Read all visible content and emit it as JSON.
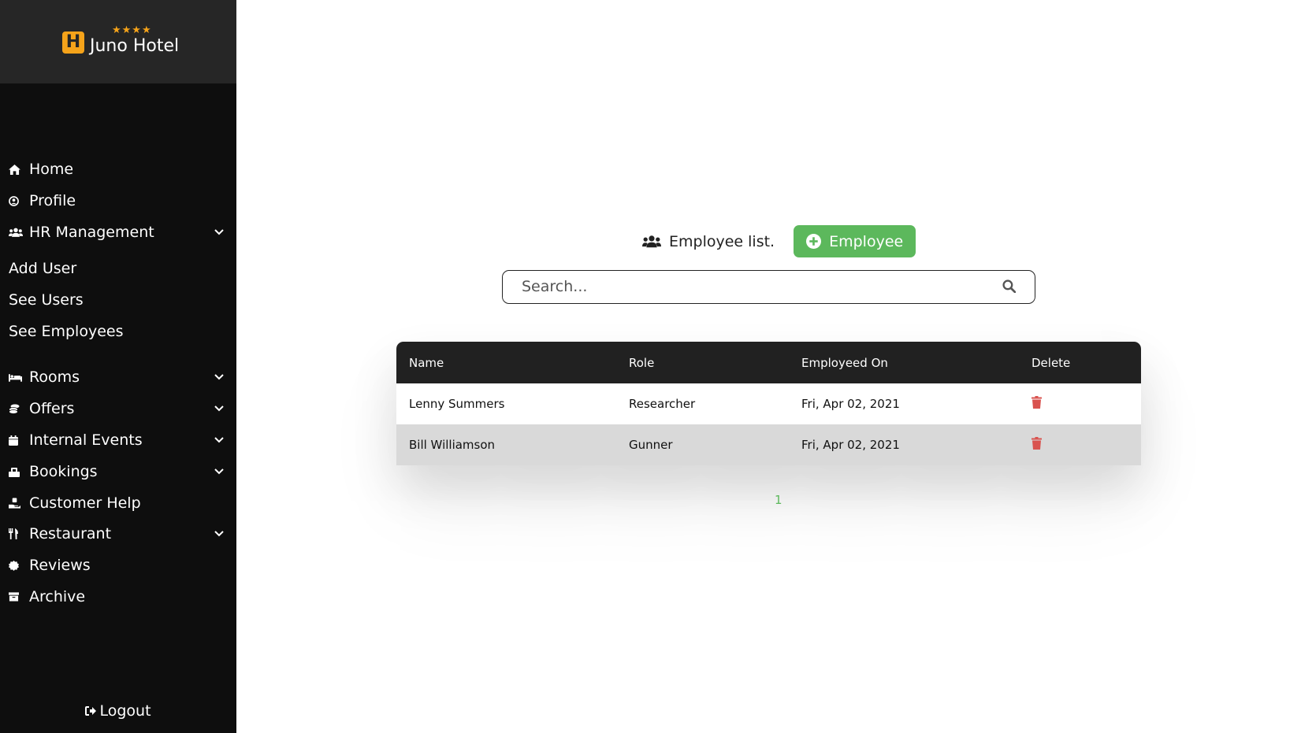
{
  "brand": {
    "stars": "★★★★",
    "logo_letter": "H",
    "name": "Juno Hotel",
    "accent": "#f5a31a"
  },
  "sidebar": {
    "items": [
      {
        "label": "Home",
        "icon": "home-icon",
        "has_submenu": false
      },
      {
        "label": "Profile",
        "icon": "user-circle-icon",
        "has_submenu": false
      },
      {
        "label": "HR Management",
        "icon": "users-icon",
        "has_submenu": true
      },
      {
        "label": "Rooms",
        "icon": "bed-icon",
        "has_submenu": true
      },
      {
        "label": "Offers",
        "icon": "coins-icon",
        "has_submenu": true
      },
      {
        "label": "Internal Events",
        "icon": "calendar-icon",
        "has_submenu": true
      },
      {
        "label": "Bookings",
        "icon": "luggage-icon",
        "has_submenu": true
      },
      {
        "label": "Customer Help",
        "icon": "hand-holding-icon",
        "has_submenu": false
      },
      {
        "label": "Restaurant",
        "icon": "utensils-icon",
        "has_submenu": true
      },
      {
        "label": "Reviews",
        "icon": "badge-icon",
        "has_submenu": false
      },
      {
        "label": "Archive",
        "icon": "archive-icon",
        "has_submenu": false
      }
    ],
    "hr_submenu": [
      "Add User",
      "See Users",
      "See Employees"
    ],
    "logout_label": "Logout"
  },
  "main": {
    "list_title": "Employee list.",
    "add_button_label": "Employee",
    "search_placeholder": "Search...",
    "table": {
      "columns": [
        "Name",
        "Role",
        "Employeed On",
        "Delete"
      ],
      "rows": [
        {
          "name": "Lenny Summers",
          "role": "Researcher",
          "employed_on": "Fri, Apr 02, 2021"
        },
        {
          "name": "Bill Williamson",
          "role": "Gunner",
          "employed_on": "Fri, Apr 02, 2021"
        }
      ]
    },
    "pagination": {
      "current_page": "1"
    }
  },
  "colors": {
    "sidebar_bg": "#0e0e0e",
    "brand_bg": "#262626",
    "success": "#5cb85c",
    "danger": "#d9534f",
    "table_header": "#212121"
  }
}
